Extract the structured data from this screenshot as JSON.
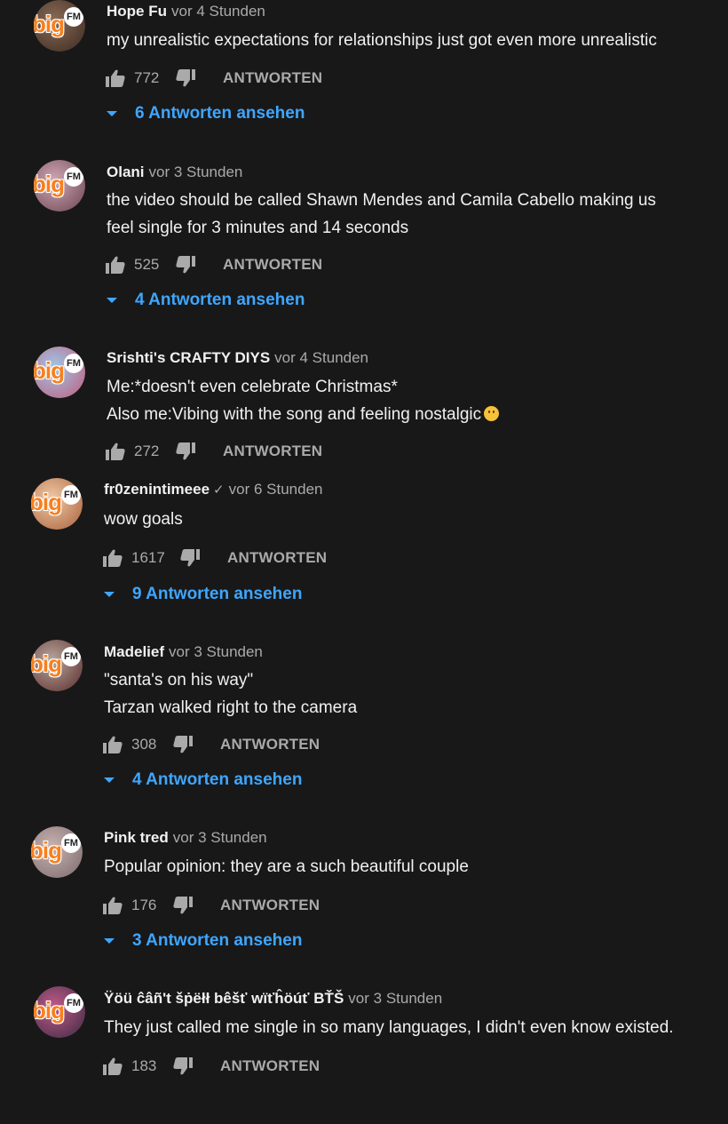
{
  "colors": {
    "background": "#181818",
    "text": "#f1f1f1",
    "muted": "#aaaaaa",
    "link": "#3ea6ff",
    "logo": "#f7801f"
  },
  "avatar_logo": {
    "big": "big",
    "fm": "FM"
  },
  "reply_label": "ANTWORTEN",
  "comments": [
    {
      "author": "Hope Fu",
      "time": "vor 4 Stunden",
      "lines": [
        "my unrealistic expectations for relationships just got even more unrealistic"
      ],
      "likes": "772",
      "replies": "6 Antworten ansehen"
    },
    {
      "author": "Olani",
      "time": "vor 3 Stunden",
      "lines": [
        "the video should be called Shawn Mendes and Camila Cabello making us",
        "feel single for 3 minutes and 14  seconds"
      ],
      "likes": "525",
      "replies": "4 Antworten ansehen"
    },
    {
      "author": "Srishti's CRAFTY DIYS",
      "time": "vor 4 Stunden",
      "lines": [
        "Me:*doesn't even celebrate Christmas*",
        "Also me:Vibing with the song and feeling nostalgic"
      ],
      "likes": "272",
      "emoji": "slightly-smiling-face-icon"
    },
    {
      "author": "fr0zenintimeee",
      "verified": "✓",
      "time": "vor 6 Stunden",
      "lines": [
        "wow goals"
      ],
      "likes": "1617",
      "replies": "9 Antworten ansehen"
    },
    {
      "author": "Madelief",
      "time": "vor 3 Stunden",
      "lines": [
        "\"santa's on his way\"",
        "Tarzan walked right to the camera"
      ],
      "likes": "308",
      "replies": "4 Antworten ansehen"
    },
    {
      "author": "Pink tred",
      "time": "vor 3 Stunden",
      "lines": [
        "Popular opinion: they are a such beautiful couple"
      ],
      "likes": "176",
      "replies": "3 Antworten ansehen"
    },
    {
      "author": "Ÿöü ĉâñ't šṗëłł bêšť wïťĥöúť BŤŠ",
      "time": "vor 3 Stunden",
      "lines": [
        "They just called me single in so many languages, I didn't even know existed."
      ],
      "likes": "183"
    }
  ]
}
